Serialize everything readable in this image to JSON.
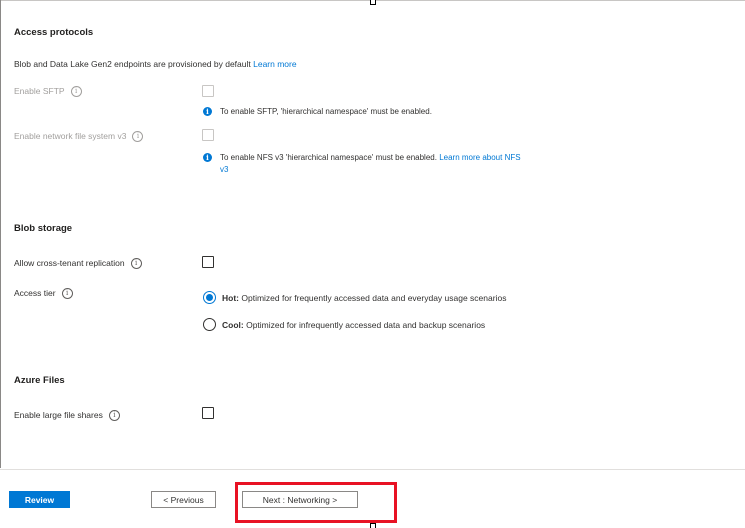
{
  "access_protocols": {
    "title": "Access protocols",
    "description": "Blob and Data Lake Gen2 endpoints are provisioned by default",
    "learn_more": "Learn more",
    "sftp_label": "Enable SFTP",
    "sftp_note": "To enable SFTP, 'hierarchical namespace' must be enabled.",
    "nfs_label": "Enable network file system v3",
    "nfs_note": "To enable NFS v3 'hierarchical namespace' must be enabled.",
    "nfs_link_line1": "Learn more about NFS",
    "nfs_link_line2": "v3"
  },
  "blob_storage": {
    "title": "Blob storage",
    "cross_tenant_label": "Allow cross-tenant replication",
    "access_tier_label": "Access tier",
    "hot_label": "Hot:",
    "hot_desc": "Optimized for frequently accessed data and everyday usage scenarios",
    "cool_label": "Cool:",
    "cool_desc": "Optimized for infrequently accessed data and backup scenarios",
    "selected_tier": "Hot"
  },
  "azure_files": {
    "title": "Azure Files",
    "large_shares_label": "Enable large file shares"
  },
  "footer": {
    "review": "Review",
    "previous": "< Previous",
    "next": "Next : Networking >"
  },
  "colors": {
    "accent": "#0078d4",
    "highlight": "#e81123"
  }
}
